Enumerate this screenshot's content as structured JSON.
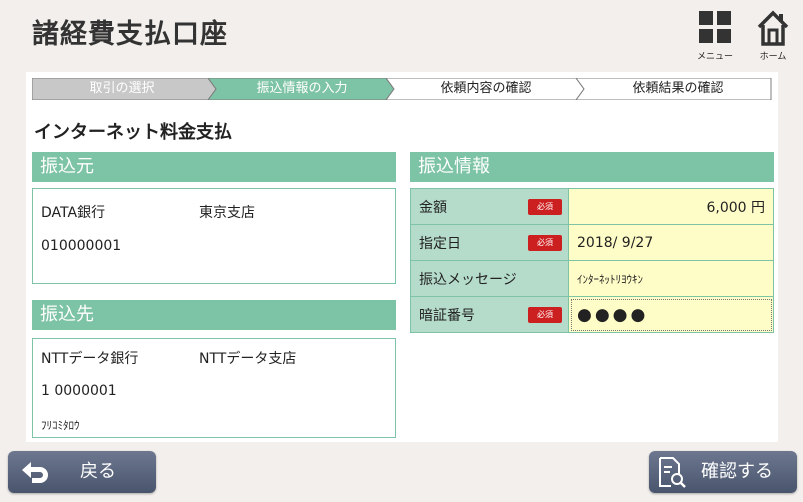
{
  "header": {
    "title": "諸経費支払口座",
    "menu_label": "メニュー",
    "home_label": "ホーム"
  },
  "steps": [
    {
      "label": "取引の選択",
      "state": "done"
    },
    {
      "label": "振込情報の入力",
      "state": "current"
    },
    {
      "label": "依頼内容の確認",
      "state": "pending"
    },
    {
      "label": "依頼結果の確認",
      "state": "pending"
    }
  ],
  "section_title": "インターネット料金支払",
  "source": {
    "header": "振込元",
    "bank": "DATA銀行",
    "branch": "東京支店",
    "account": "010000001"
  },
  "destination": {
    "header": "振込先",
    "bank": "NTTデータ銀行",
    "branch": "NTTデータ支店",
    "account": "1 0000001",
    "name": "ﾌﾘｺﾐﾀﾛｳ"
  },
  "transfer_info": {
    "header": "振込情報",
    "required_label": "必須",
    "amount_label": "金額",
    "amount_value": "6,000 円",
    "date_label": "指定日",
    "date_value": "2018/ 9/27",
    "message_label": "振込メッセージ",
    "message_value": "ｲﾝﾀｰﾈｯﾄﾘﾖｳｷﾝ",
    "pin_label": "暗証番号",
    "pin_value": "●●●●"
  },
  "footer": {
    "back_label": "戻る",
    "confirm_label": "確認する"
  },
  "colors": {
    "accent": "#7dc3a5",
    "label_bg": "#b5dccb",
    "value_bg": "#fffdc7",
    "required": "#cc1f1f",
    "button": "#56617a"
  }
}
